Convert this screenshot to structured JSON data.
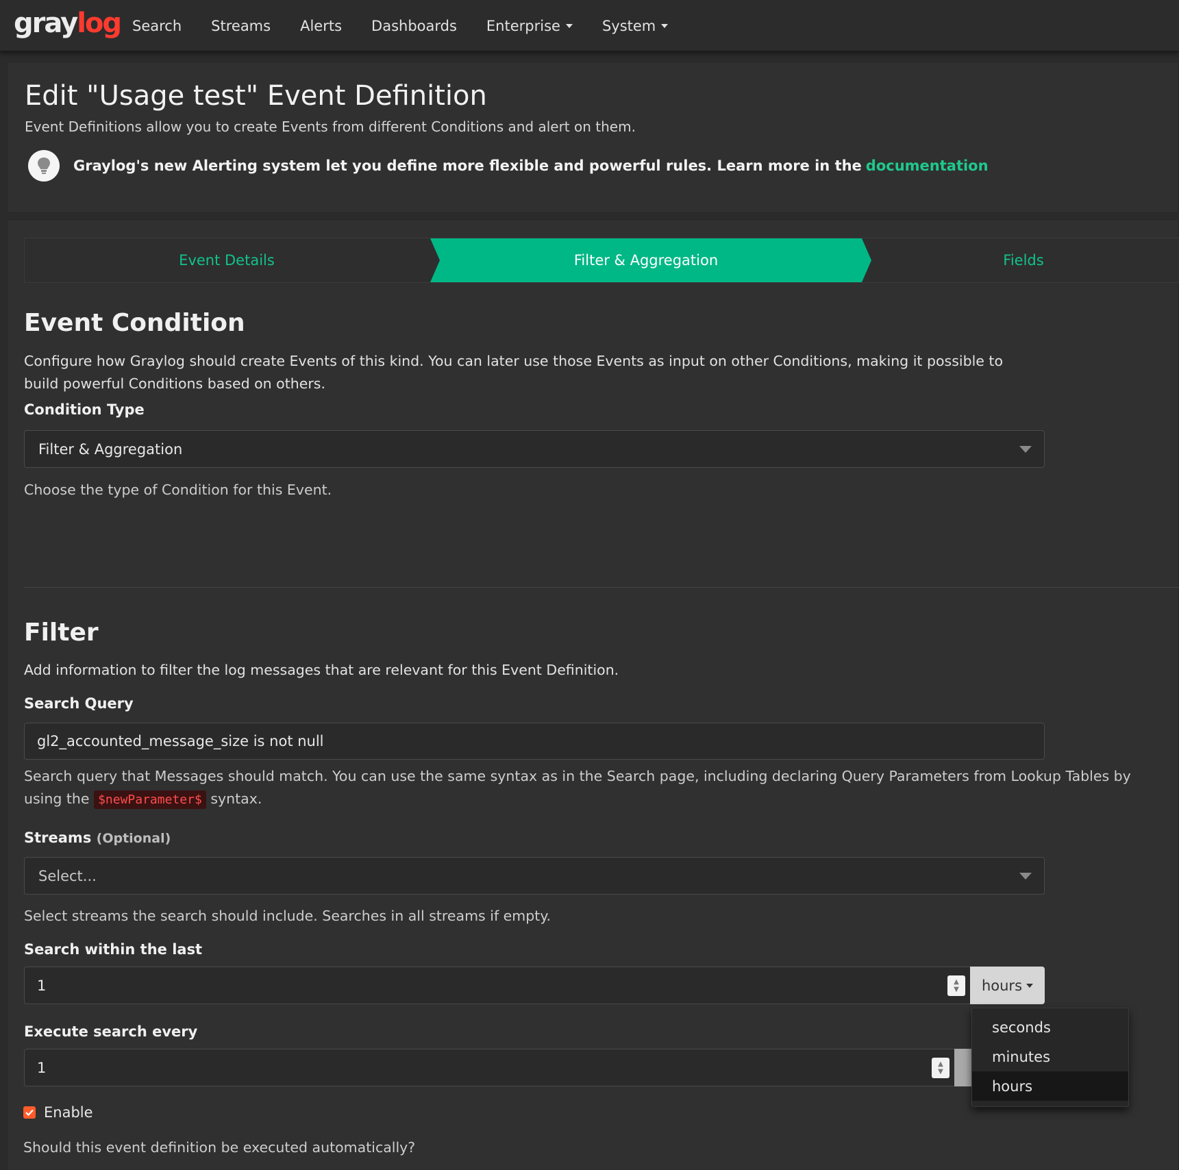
{
  "nav": {
    "logo_gray": "gray",
    "logo_log": "log",
    "items": [
      {
        "label": "Search"
      },
      {
        "label": "Streams"
      },
      {
        "label": "Alerts"
      },
      {
        "label": "Dashboards"
      },
      {
        "label": "Enterprise"
      },
      {
        "label": "System"
      }
    ]
  },
  "header": {
    "title": "Edit \"Usage test\" Event Definition",
    "description": "Event Definitions allow you to create Events from different Conditions and alert on them.",
    "info_text": "Graylog's new Alerting system let you define more flexible and powerful rules. Learn more in the",
    "info_link": "documentation"
  },
  "wizard": {
    "steps": [
      {
        "label": "Event Details"
      },
      {
        "label": "Filter & Aggregation"
      },
      {
        "label": "Fields"
      }
    ],
    "active_step": 1
  },
  "event_condition": {
    "title": "Event Condition",
    "description": "Configure how Graylog should create Events of this kind. You can later use those Events as input on other Conditions, making it possible to build powerful Conditions based on others.",
    "condition_type_label": "Condition Type",
    "condition_type_value": "Filter & Aggregation",
    "condition_type_help": "Choose the type of Condition for this Event."
  },
  "filter": {
    "title": "Filter",
    "description": "Add information to filter the log messages that are relevant for this Event Definition.",
    "search_query_label": "Search Query",
    "search_query_value": "gl2_accounted_message_size is not null",
    "search_query_help_1": "Search query that Messages should match. You can use the same syntax as in the Search page, including declaring Query Parameters from Lookup Tables by",
    "search_query_help_2": "using the",
    "search_query_help_code": "$newParameter$",
    "search_query_help_3": "syntax.",
    "streams_label": "Streams",
    "streams_optional": "(Optional)",
    "streams_placeholder": "Select...",
    "streams_help": "Select streams the search should include. Searches in all streams if empty.",
    "search_within_label": "Search within the last",
    "search_within_value": "1",
    "search_within_unit": "hours",
    "execute_every_label": "Execute search every",
    "execute_every_value": "1",
    "unit_options": [
      "seconds",
      "minutes",
      "hours"
    ],
    "unit_selected": "hours",
    "enable_label": "Enable",
    "enable_checked": true,
    "enable_help": "Should this event definition be executed automatically?"
  },
  "colors": {
    "accent": "#00b886",
    "link": "#1fc98e",
    "checkbox": "#ff5c2a",
    "logo_red": "#ff3b30"
  }
}
